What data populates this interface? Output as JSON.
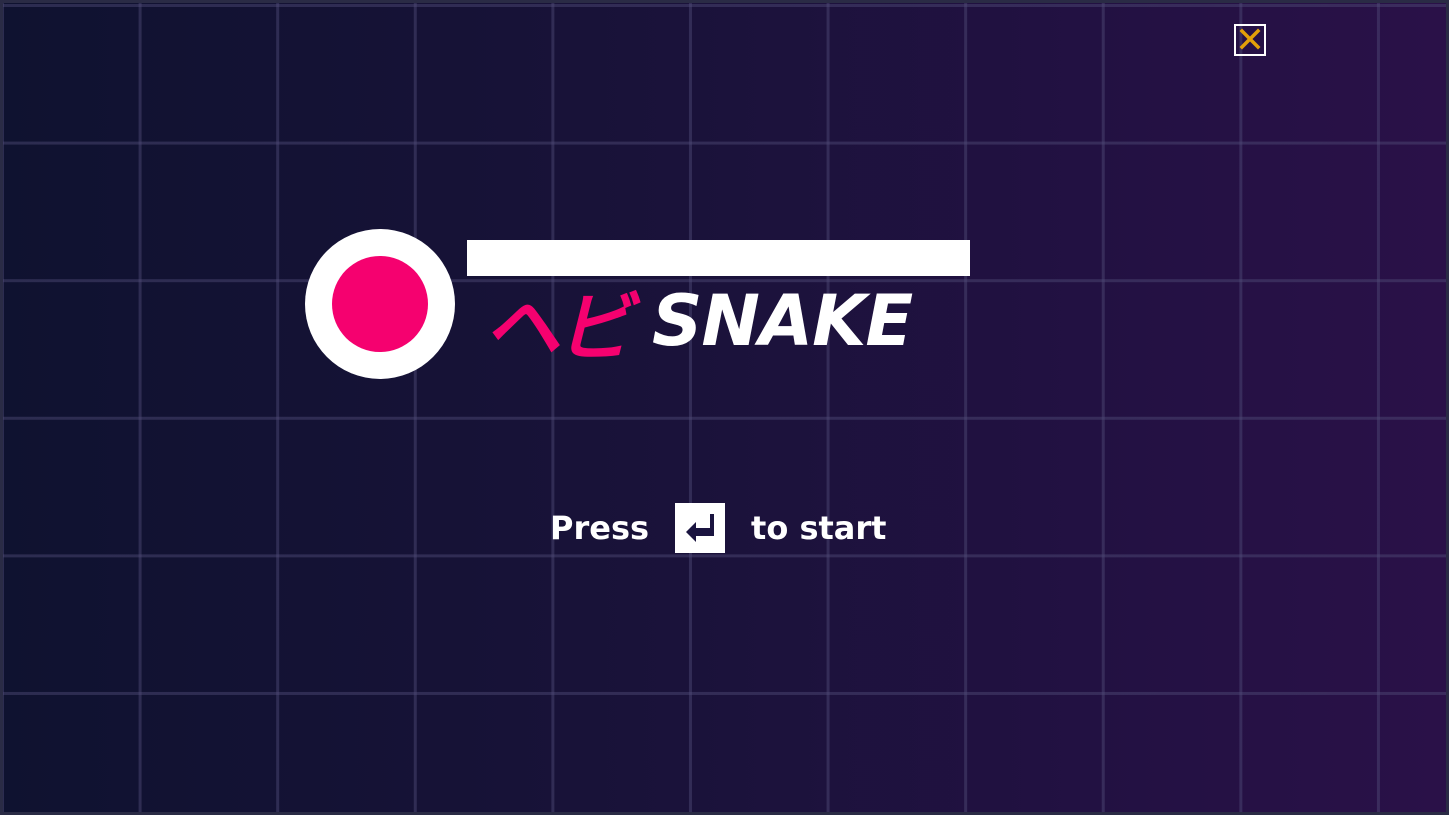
{
  "game": {
    "title_jp": "ヘビ",
    "title_en": "SNAKE"
  },
  "start_prompt": {
    "before": "Press",
    "key_icon": "enter-key-icon",
    "after": "to start"
  },
  "close_button": {
    "icon": "close-icon"
  },
  "colors": {
    "accent": "#f5016f",
    "background_left": "#0f1230",
    "background_right": "#2a1148",
    "grid_line": "#3a3560",
    "close_icon": "#e3a008",
    "text": "#ffffff"
  }
}
